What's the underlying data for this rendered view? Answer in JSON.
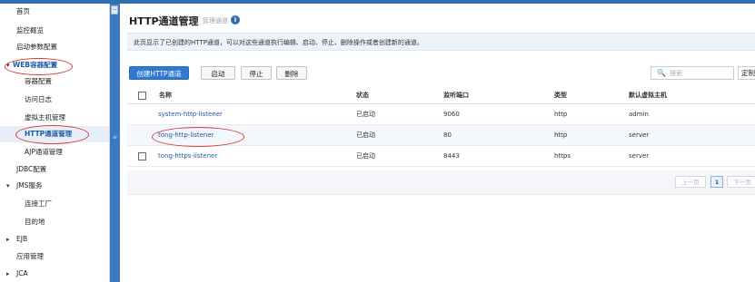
{
  "sidebar": {
    "items": [
      {
        "label": "首页"
      },
      {
        "label": "监控概览"
      },
      {
        "label": "启动参数配置"
      },
      {
        "label": "WEB容器配置",
        "caret": "▾"
      },
      {
        "label": "容器配置"
      },
      {
        "label": "访问日志"
      },
      {
        "label": "虚拟主机管理"
      },
      {
        "label": "HTTP通道管理"
      },
      {
        "label": "AJP通道管理"
      },
      {
        "label": "JDBC配置"
      },
      {
        "label": "JMS服务",
        "caret": "▾"
      },
      {
        "label": "连接工厂"
      },
      {
        "label": "目的地"
      },
      {
        "label": "EJB",
        "caret": "▸"
      },
      {
        "label": "应用管理"
      },
      {
        "label": "JCA",
        "caret": "▸"
      }
    ]
  },
  "splitter": {
    "collapse_glyph": "−",
    "handle_glyph": "≡"
  },
  "header": {
    "title": "HTTP通道管理",
    "subtitle": "管理通道",
    "info_glyph": "i"
  },
  "description": "此页显示了已创建的HTTP通道，可以对这些通道执行编辑、启动、停止、删除操作或者创建新的通道。",
  "toolbar": {
    "create": "创建HTTP通道",
    "start": "启动",
    "stop": "停止",
    "delete": "删除"
  },
  "search": {
    "placeholder": "搜索",
    "icon": "search-icon",
    "icon_glyph": "🔍"
  },
  "custom_label": "定制",
  "table": {
    "headers": [
      "名称",
      "状态",
      "监听端口",
      "类型",
      "默认虚拟主机"
    ],
    "rows": [
      {
        "name": "system-http-listener",
        "status": "已启动",
        "port": "9060",
        "type": "http",
        "host": "admin"
      },
      {
        "name": "tong-http-listener",
        "status": "已启动",
        "port": "80",
        "type": "http",
        "host": "server"
      },
      {
        "name": "tong-https-listener",
        "status": "已启动",
        "port": "8443",
        "type": "https",
        "host": "server"
      }
    ]
  },
  "pager": {
    "prev": "上一页",
    "current": "1",
    "next": "下一页"
  },
  "colors": {
    "accent": "#2f7ad0",
    "link": "#1d5aa6",
    "annotation": "#d63a3a",
    "splitter": "#3d78c2"
  }
}
